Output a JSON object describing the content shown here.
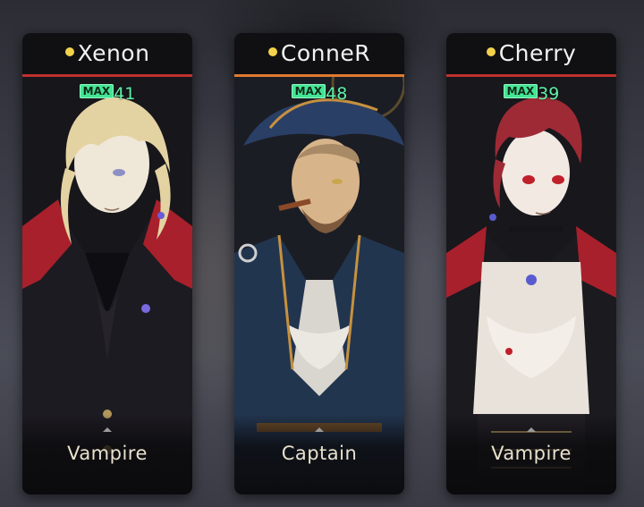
{
  "characters": [
    {
      "name": "Xenon",
      "max_label": "MAX",
      "level": "41",
      "class": "Vampire",
      "accent_color": "#c0302f",
      "hair_color": "#e4d3a2",
      "coat_color": "#1c1a20",
      "collar_color": "#b0202a"
    },
    {
      "name": "ConneR",
      "max_label": "MAX",
      "level": "48",
      "class": "Captain",
      "accent_color": "#e07a2f",
      "hair_color": "#a98a66",
      "coat_color": "#22354f",
      "collar_color": "#d9d5cf"
    },
    {
      "name": "Cherry",
      "max_label": "MAX",
      "level": "39",
      "class": "Vampire",
      "accent_color": "#c0302f",
      "hair_color": "#9e2a35",
      "coat_color": "#1b1a1f",
      "collar_color": "#b0202a"
    }
  ]
}
